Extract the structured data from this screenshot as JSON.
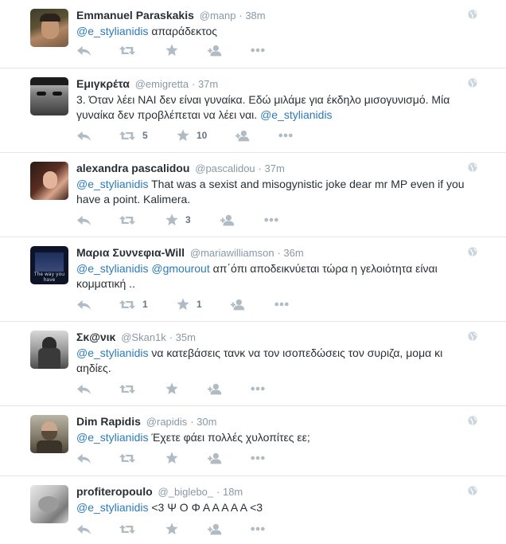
{
  "tweets": [
    {
      "fullname": "Emmanuel Paraskakis",
      "username": "@manp",
      "time": "· 38m",
      "mention": "@e_stylianidis",
      "text_rest": " απαράδεκτος",
      "retweets": "",
      "favorites": ""
    },
    {
      "fullname": "Εμιγκρέτα",
      "username": "@emigretta",
      "time": "· 37m",
      "text_before": "3. Όταν λέει ΝΑΙ δεν είναι γυναίκα. Εδώ μιλάμε για έκδηλο μισογυνισμό. Μία γυναίκα δεν προβλέπεται να λέει ναι. ",
      "mention": "@e_stylianidis",
      "retweets": "5",
      "favorites": "10"
    },
    {
      "fullname": "alexandra pascalidou",
      "username": "@pascalidou",
      "time": "· 37m",
      "mention": "@e_stylianidis",
      "text_rest": " That was a sexist and misogynistic joke dear mr MP even if you have a point. Kalimera.",
      "retweets": "",
      "favorites": "3"
    },
    {
      "fullname": "Μαρια Συννεφια-Will",
      "username": "@mariawilliamson",
      "time": "· 36m",
      "mention": "@e_stylianidis",
      "mention2": "@gmourout",
      "text_rest": " απ΄όπι αποδεικνύεται τώρα η γελοιότητα είναι κομματική ..",
      "avatar_caption": "The way you have",
      "retweets": "1",
      "favorites": "1"
    },
    {
      "fullname": "Σκ@νικ",
      "username": "@Skan1k",
      "time": "· 35m",
      "mention": "@e_stylianidis",
      "text_rest": " να κατεβάσεις τανκ να τον ισοπεδώσεις τον συριζα, μομα κι αηδίες.",
      "retweets": "",
      "favorites": ""
    },
    {
      "fullname": "Dim Rapidis",
      "username": "@rapidis",
      "time": "· 30m",
      "mention": "@e_stylianidis",
      "text_rest": " Έχετε φάει πολλές χυλοπίτες εε;",
      "retweets": "",
      "favorites": ""
    },
    {
      "fullname": "profiteropoulo",
      "username": "@_biglebo_",
      "time": "· 18m",
      "mention": "@e_stylianidis",
      "text_rest": " <3 Ψ Ο Φ Α Α Α Α Α <3",
      "retweets": "",
      "favorites": ""
    }
  ],
  "icons": {
    "reply": "reply-icon",
    "retweet": "retweet-icon",
    "favorite": "star-icon",
    "follow": "follow-icon",
    "more": "more-icon",
    "globe": "globe-icon"
  },
  "colors": {
    "link": "#2b7bb9",
    "muted": "#8899a6",
    "text": "#292f33",
    "icon": "#8899a6",
    "divider": "#e1e8ed"
  }
}
